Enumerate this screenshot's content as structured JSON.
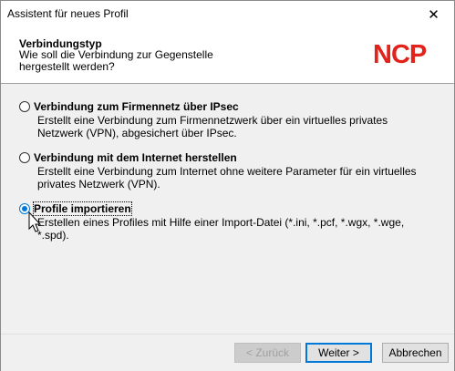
{
  "window": {
    "title": "Assistent für neues Profil",
    "close_icon": "close-icon"
  },
  "header": {
    "title": "Verbindungstyp",
    "subtitle": "Wie soll die Verbindung zur Gegenstelle hergestellt werden?",
    "logo_text": "NCP",
    "logo_color": "#e2231a"
  },
  "options": [
    {
      "label": "Verbindung zum Firmennetz über IPsec",
      "description": "Erstellt eine Verbindung zum Firmennetzwerk über ein virtuelles privates Netzwerk (VPN), abgesichert über IPsec.",
      "selected": false
    },
    {
      "label": "Verbindung mit dem Internet herstellen",
      "description": "Erstellt eine Verbindung zum Internet ohne weitere Parameter für ein virtuelles privates Netzwerk (VPN).",
      "selected": false
    },
    {
      "label": "Profile importieren",
      "description": "Erstellen eines Profiles mit Hilfe einer Import-Datei (*.ini, *.pcf, *.wgx, *.wge, *.spd).",
      "selected": true
    }
  ],
  "footer": {
    "back_label": "< Zurück",
    "next_label": "Weiter >",
    "cancel_label": "Abbrechen"
  },
  "colors": {
    "accent": "#0078d7"
  }
}
